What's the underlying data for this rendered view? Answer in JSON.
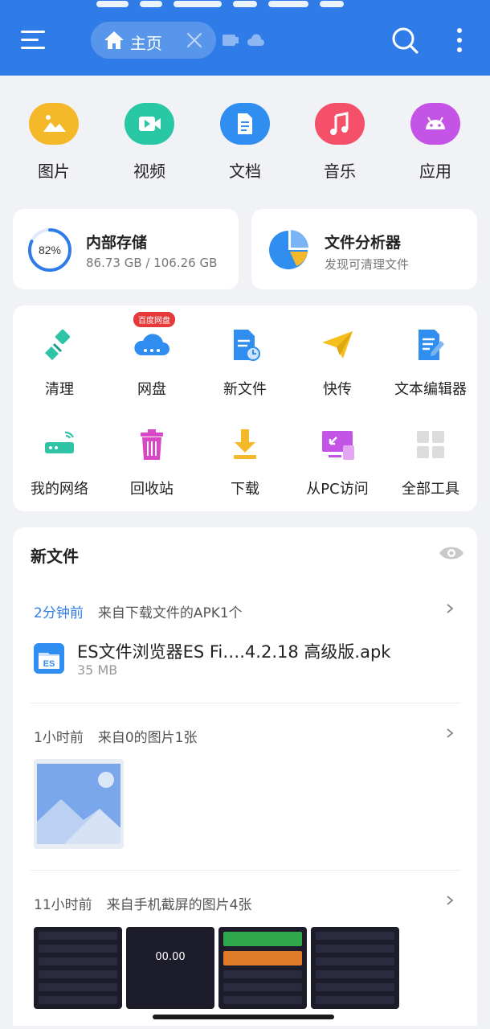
{
  "header": {
    "tab_label": "主页",
    "accent": "#2f7ce8"
  },
  "categories": [
    {
      "label": "图片",
      "icon": "image-icon",
      "color": "#f5b829"
    },
    {
      "label": "视频",
      "icon": "video-icon",
      "color": "#28c8a4"
    },
    {
      "label": "文档",
      "icon": "document-icon",
      "color": "#2f8ef0"
    },
    {
      "label": "音乐",
      "icon": "music-icon",
      "color": "#f5506a"
    },
    {
      "label": "应用",
      "icon": "android-icon",
      "color": "#c354e6"
    }
  ],
  "storage": {
    "title": "内部存储",
    "percent_label": "82%",
    "percent": 82,
    "usage": "86.73 GB / 106.26 GB"
  },
  "analyzer": {
    "title": "文件分析器",
    "subtitle": "发现可清理文件"
  },
  "tools": [
    {
      "label": "清理",
      "icon": "broom-icon"
    },
    {
      "label": "网盘",
      "icon": "cloud-drive-icon",
      "badge": "百度网盘"
    },
    {
      "label": "新文件",
      "icon": "new-file-icon"
    },
    {
      "label": "快传",
      "icon": "paper-plane-icon"
    },
    {
      "label": "文本编辑器",
      "icon": "text-editor-icon"
    },
    {
      "label": "我的网络",
      "icon": "router-icon"
    },
    {
      "label": "回收站",
      "icon": "trash-icon"
    },
    {
      "label": "下载",
      "icon": "download-icon"
    },
    {
      "label": "从PC访问",
      "icon": "pc-access-icon"
    },
    {
      "label": "全部工具",
      "icon": "grid-icon"
    }
  ],
  "new_files": {
    "title": "新文件",
    "groups": [
      {
        "time": "2分钟前",
        "desc": "来自下载文件的APK1个"
      },
      {
        "time": "1小时前",
        "desc": "来自0的图片1张"
      },
      {
        "time": "11小时前",
        "desc": "来自手机截屏的图片4张"
      }
    ],
    "apk": {
      "name": "ES文件浏览器ES Fi….4.2.18 高级版.apk",
      "size": "35 MB"
    },
    "thumb_clock": "00.00"
  }
}
